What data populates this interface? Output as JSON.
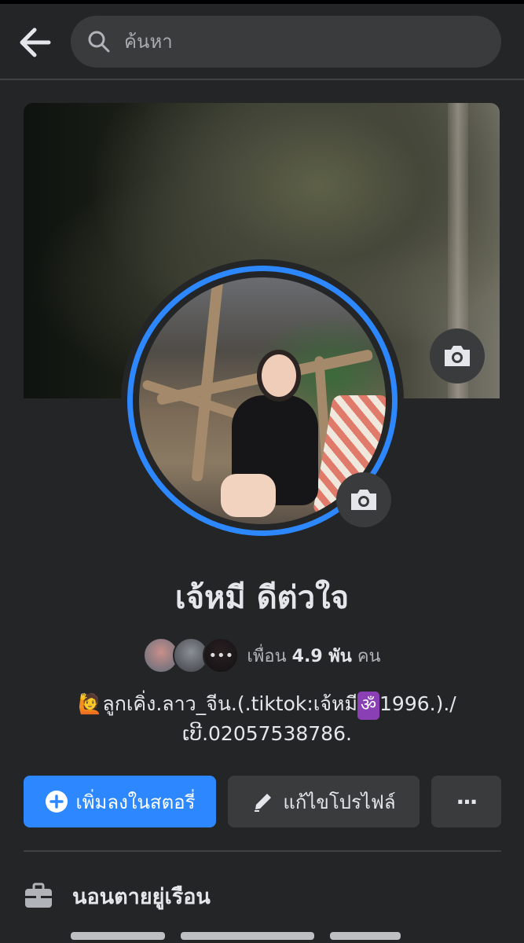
{
  "search": {
    "placeholder": "ค้นหา"
  },
  "profile": {
    "name": "เจ้หมี ดีต่วใจ",
    "friends_label": "เพื่อน",
    "friends_count": "4.9 พัน",
    "friends_unit": "คน",
    "bio_emoji": "🙋",
    "bio_part1": "ลูกเคิ่ง.ลาว_จีน.(.tiktok:เจ้หมี",
    "bio_om": "ॐ",
    "bio_part2": "1996.)./",
    "bio_line2": "ເບີ.02057538786."
  },
  "actions": {
    "add_story": "เพิ่มลงในสตอรี่",
    "edit_profile": "แก้ไขโปรไฟล์",
    "more": "···"
  },
  "info": {
    "work": "นอนตายยู่เรือน"
  },
  "colors": {
    "accent": "#2d88ff",
    "background": "#242526",
    "surface": "#3a3b3c"
  }
}
